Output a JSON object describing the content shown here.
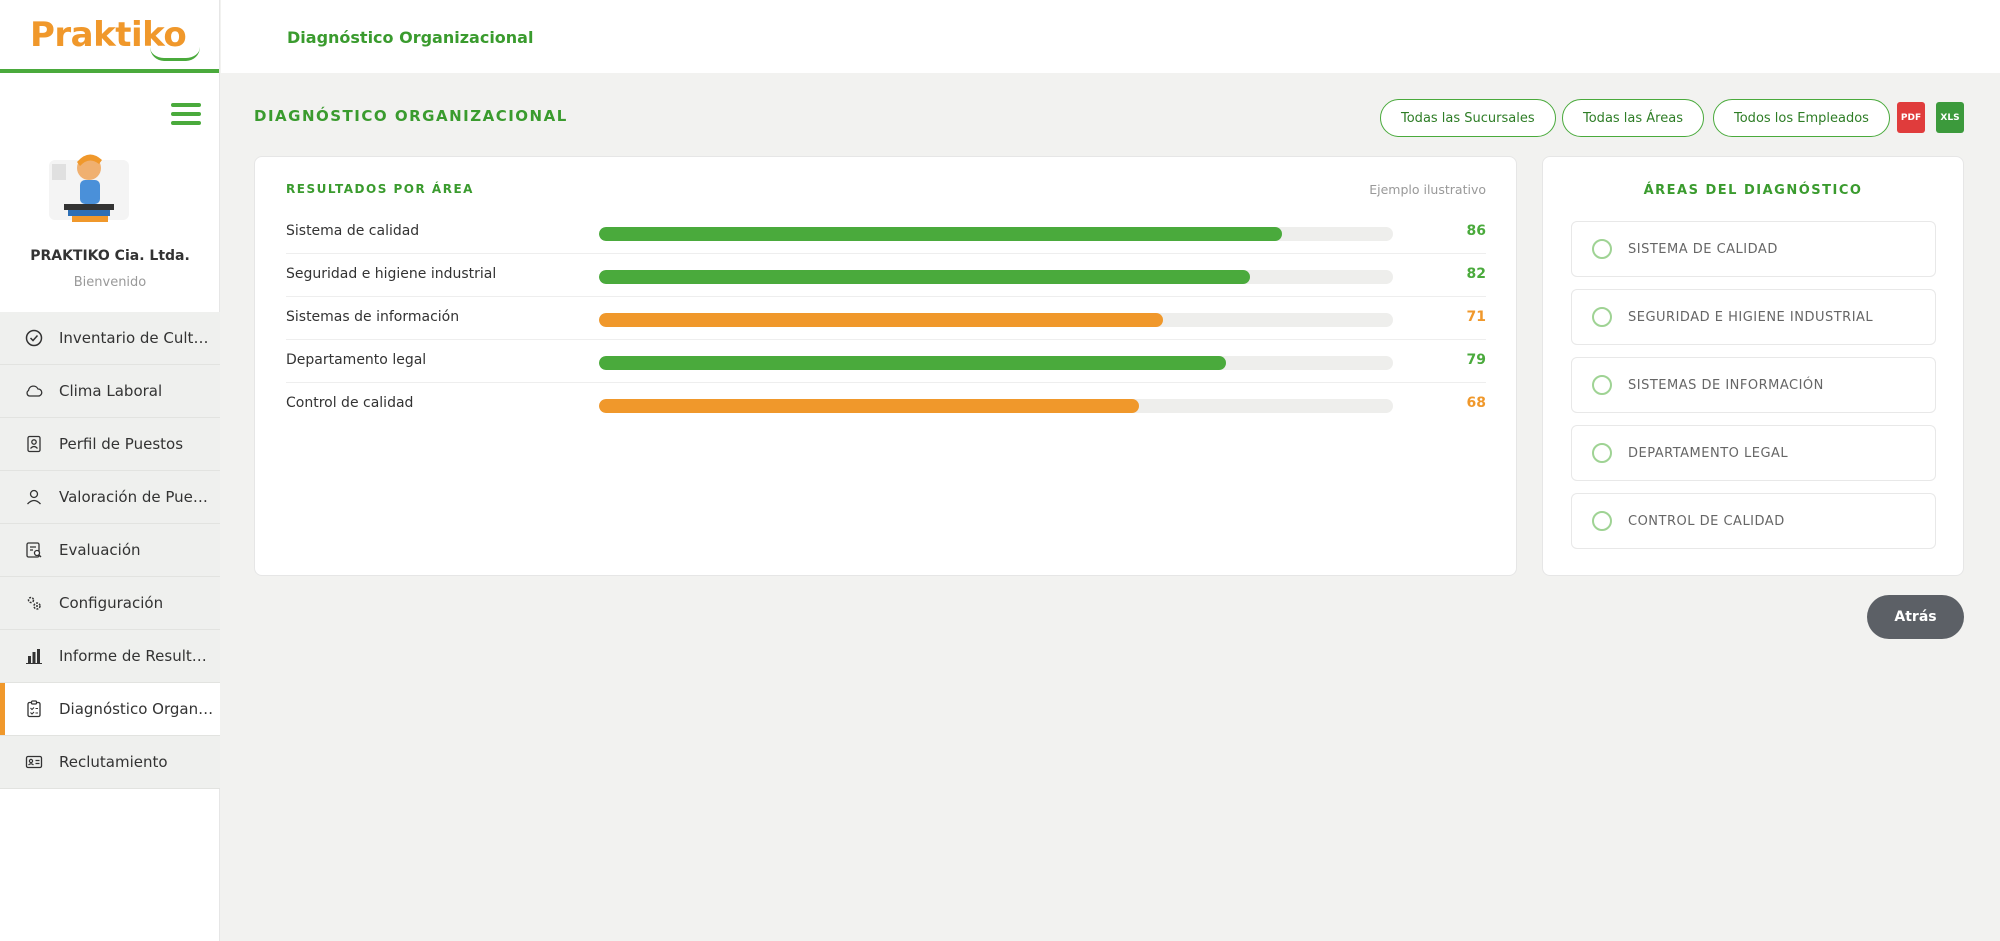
{
  "brand": {
    "logo_text": "Praktiko",
    "primary_color": "#4aaa3c",
    "accent_color": "#f0982b"
  },
  "sidebar": {
    "company": "PRAKTIKO Cia. Ltda.",
    "welcome": "Bienvenido",
    "items": [
      {
        "label": "Inventario de Cultura Organizacional",
        "icon": "check-circle-icon"
      },
      {
        "label": "Clima Laboral",
        "icon": "cloud-icon"
      },
      {
        "label": "Perfil de Puestos",
        "icon": "id-badge-icon"
      },
      {
        "label": "Valoración de Puestos",
        "icon": "user-icon"
      },
      {
        "label": "Evaluación",
        "icon": "document-search-icon"
      },
      {
        "label": "Configuración",
        "icon": "gears-icon"
      },
      {
        "label": "Informe de Resultados",
        "icon": "bar-chart-icon"
      },
      {
        "label": "Diagnóstico Organizacional",
        "icon": "clipboard-check-icon",
        "active": true
      },
      {
        "label": "Reclutamiento",
        "icon": "id-card-icon"
      }
    ]
  },
  "topbar": {
    "title": "Diagnóstico Organizacional"
  },
  "main": {
    "title": "DIAGNÓSTICO ORGANIZACIONAL",
    "filters": [
      "Todas las Sucursales",
      "Todas las Áreas",
      "Todos los Empleados"
    ],
    "export": {
      "pdf": "PDF",
      "xls": "XLS",
      "pdf_color": "#e03c3c",
      "xls_color": "#3c9a3c"
    },
    "results": {
      "heading": "RESULTADOS POR ÁREA",
      "note": "Ejemplo ilustrativo",
      "rows": [
        {
          "label": "Sistema de calidad",
          "value": 86,
          "color": "#4aaa3c"
        },
        {
          "label": "Seguridad e higiene industrial",
          "value": 82,
          "color": "#4aaa3c"
        },
        {
          "label": "Sistemas de información",
          "value": 71,
          "color": "#f0982b"
        },
        {
          "label": "Departamento legal",
          "value": 79,
          "color": "#4aaa3c"
        },
        {
          "label": "Control de calidad",
          "value": 68,
          "color": "#f0982b"
        }
      ]
    },
    "areas": {
      "heading": "ÁREAS DEL DIAGNÓSTICO",
      "items": [
        "SISTEMA DE CALIDAD",
        "SEGURIDAD E HIGIENE INDUSTRIAL",
        "SISTEMAS DE INFORMACIÓN",
        "DEPARTAMENTO LEGAL",
        "CONTROL DE CALIDAD"
      ]
    },
    "back_label": "Atrás"
  }
}
